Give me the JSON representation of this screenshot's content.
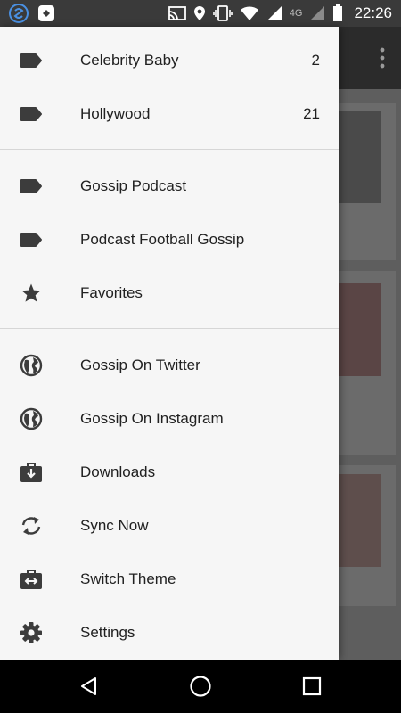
{
  "status_bar": {
    "time": "22:26",
    "network_label": "4G",
    "icons": [
      "app-s-icon",
      "app-notification-icon",
      "cast-icon",
      "location-icon",
      "vibrate-icon",
      "wifi-icon",
      "signal-icon",
      "battery-icon"
    ]
  },
  "drawer": {
    "items": [
      {
        "label": "Celebrity Baby",
        "count": "2",
        "icon": "label-icon"
      },
      {
        "label": "Hollywood",
        "count": "21",
        "icon": "label-icon"
      },
      {
        "label": "Gossip Podcast",
        "icon": "label-icon"
      },
      {
        "label": "Podcast Football Gossip",
        "icon": "label-icon"
      },
      {
        "label": "Favorites",
        "icon": "star-icon"
      },
      {
        "label": "Gossip On Twitter",
        "icon": "globe-icon"
      },
      {
        "label": "Gossip On Instagram",
        "icon": "globe-icon"
      },
      {
        "label": "Downloads",
        "icon": "download-icon"
      },
      {
        "label": "Sync Now",
        "icon": "sync-icon"
      },
      {
        "label": "Switch Theme",
        "icon": "switch-theme-icon"
      },
      {
        "label": "Settings",
        "icon": "gear-icon"
      }
    ]
  },
  "nav_bar": {
    "buttons": [
      "back-button",
      "home-button",
      "recents-button"
    ]
  },
  "colors": {
    "drawer_bg": "#f6f6f6",
    "icon": "#3c3c3c",
    "status_bar": "#3a3a3a",
    "scrim": "#5e5e5e"
  }
}
